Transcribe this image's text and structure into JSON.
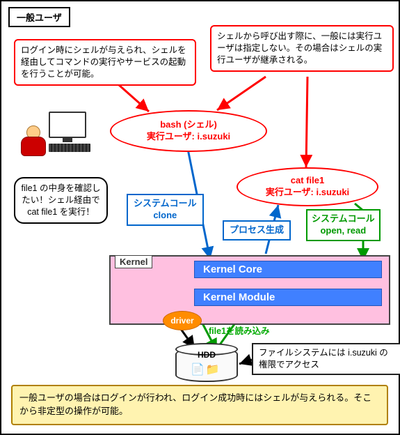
{
  "title": "一般ユーザ",
  "callout_shell": "ログイン時にシェルが与えられ、シェルを経由してコマンドの実行やサービスの起動を行うことが可能。",
  "callout_invoke": "シェルから呼び出す際に、一般には実行ユーザは指定しない。その場合はシェルの実行ユーザが継承される。",
  "bash": {
    "line1": "bash (シェル)",
    "line2": "実行ユーザ: i.suzuki"
  },
  "cat": {
    "line1": "cat file1",
    "line2": "実行ユーザ: i.suzuki"
  },
  "think": "file1 の中身を確認したい！シェル経由で cat file1 を実行！",
  "syscall_clone": {
    "l1": "システムコール",
    "l2": "clone"
  },
  "proc_gen": "プロセス生成",
  "syscall_open": {
    "l1": "システムコール",
    "l2": "open, read"
  },
  "kernel": {
    "label": "Kernel",
    "core": "Kernel Core",
    "module": "Kernel Module",
    "driver": "driver"
  },
  "read_label": "file1を読み込み",
  "hdd": "HDD",
  "fs_note": "ファイルシステムには i.suzuki の権限でアクセス",
  "summary": "一般ユーザの場合はログインが行われ、ログイン成功時にはシェルが与えられる。そこから非定型の操作が可能。"
}
